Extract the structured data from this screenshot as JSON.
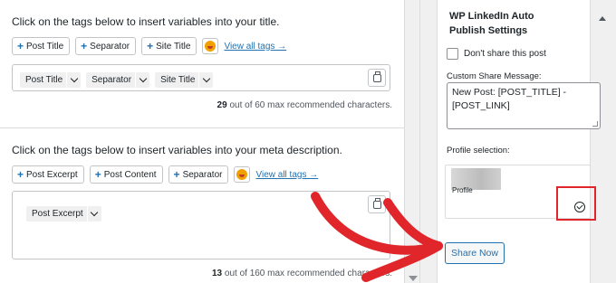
{
  "title_section": {
    "instruction": "Click on the tags below to insert variables into your title.",
    "tags": [
      "Post Title",
      "Separator",
      "Site Title"
    ],
    "view_all": "View all tags →",
    "pills": [
      "Post Title",
      "Separator",
      "Site Title"
    ],
    "count": "29",
    "count_suffix": " out of ",
    "max": "60",
    "max_suffix": " max recommended characters."
  },
  "meta_section": {
    "instruction": "Click on the tags below to insert variables into your meta description.",
    "tags": [
      "Post Excerpt",
      "Post Content",
      "Separator"
    ],
    "view_all": "View all tags →",
    "pills": [
      "Post Excerpt"
    ],
    "count": "13",
    "count_suffix": " out of ",
    "max": "160",
    "max_suffix": " max recommended characters."
  },
  "sidebar": {
    "panel_title": "WP LinkedIn Auto Publish Settings",
    "dont_share_label": "Don't share this post",
    "custom_message_label": "Custom Share Message:",
    "custom_message_value": "New Post: [POST_TITLE] - [POST_LINK]",
    "profile_selection_label": "Profile selection:",
    "profile_name": "Profile",
    "share_button": "Share Now"
  },
  "icons": {
    "tag_add": "plus-icon",
    "emoji": "emoji-icon",
    "reset": "reset-icon",
    "collapse": "chevron-up-icon",
    "profile_selected": "check-circle-icon",
    "annotation": "red-arrow-icon"
  },
  "colors": {
    "link": "#2271b1",
    "annotation": "#e0262b"
  }
}
